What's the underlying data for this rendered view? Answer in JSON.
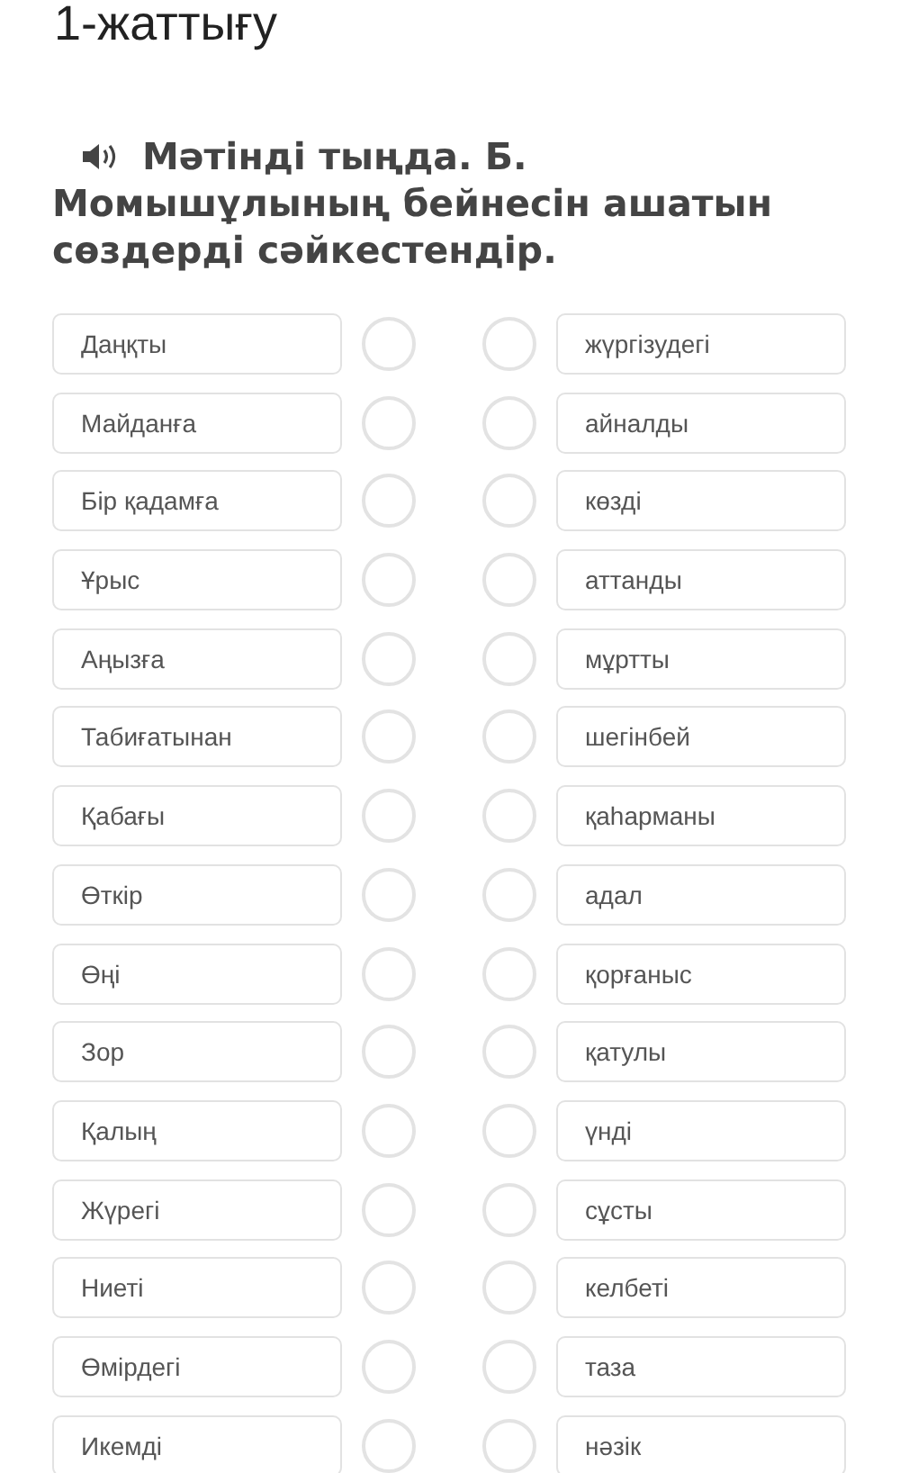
{
  "title": "1-жаттығу",
  "instruction": [
    "Мәтінді тыңда. Б.",
    "Момышұлының бейнесін ашатын сөздерді сәйкестендір."
  ],
  "pairs": [
    {
      "left": "Даңқты",
      "right": "жүргізудегі"
    },
    {
      "left": "Майданға",
      "right": "айналды"
    },
    {
      "left": "Бір қадамға",
      "right": "көзді"
    },
    {
      "left": "Ұрыс",
      "right": "аттанды"
    },
    {
      "left": "Аңызға",
      "right": "мұртты"
    },
    {
      "left": "Табиғатынан",
      "right": "шегінбей"
    },
    {
      "left": "Қабағы",
      "right": "қаһарманы"
    },
    {
      "left": "Өткір",
      "right": "адал"
    },
    {
      "left": "Өңі",
      "right": "қорғаныс"
    },
    {
      "left": "Зор",
      "right": "қатулы"
    },
    {
      "left": "Қалың",
      "right": "үнді"
    },
    {
      "left": "Жүрегі",
      "right": "сұсты"
    },
    {
      "left": "Ниеті",
      "right": "келбеті"
    },
    {
      "left": "Өмірдегі",
      "right": "таза"
    },
    {
      "left": "Икемді",
      "right": "нәзік"
    }
  ]
}
